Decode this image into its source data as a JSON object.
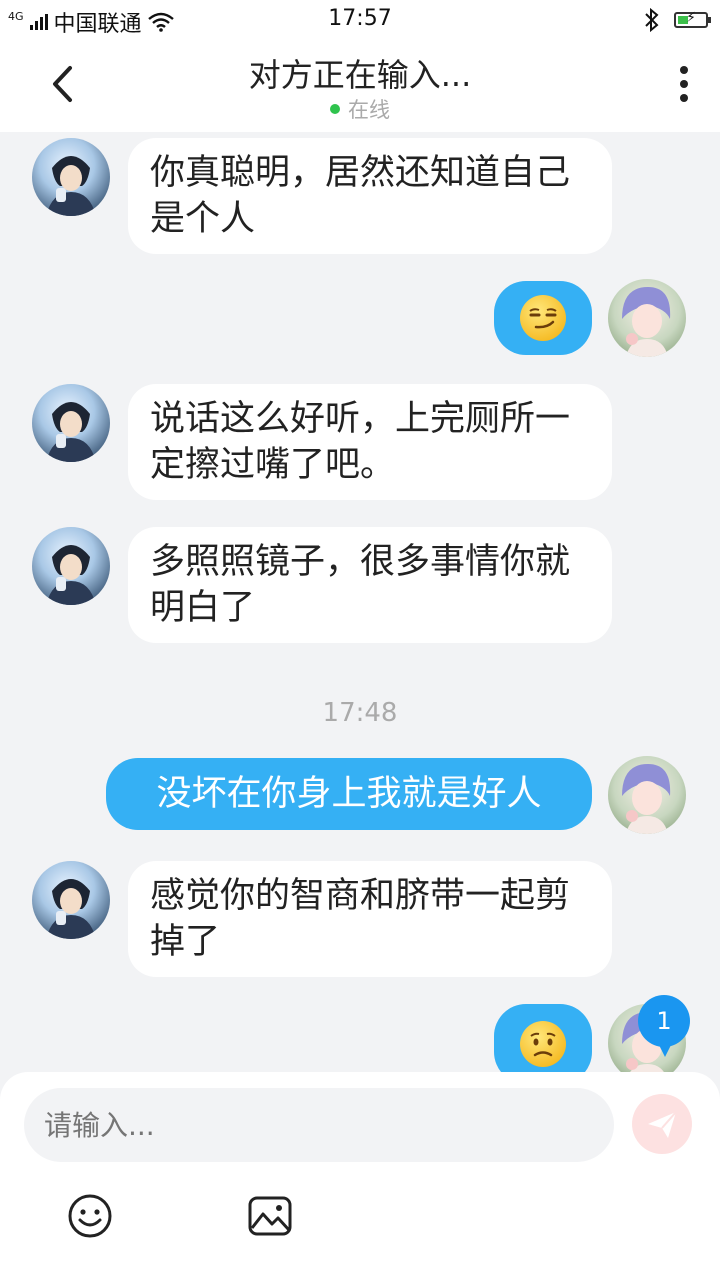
{
  "status_bar": {
    "network": "4G",
    "carrier": "中国联通",
    "time": "17:57"
  },
  "header": {
    "title": "对方正在输入...",
    "status": "在线",
    "online_color": "#2fc34d"
  },
  "messages": [
    {
      "side": "in",
      "text": "你真聪明，居然还知道自己是个人"
    },
    {
      "side": "out",
      "emoji": "smirk"
    },
    {
      "side": "in",
      "text": "说话这么好听，上完厕所一定擦过嘴了吧。"
    },
    {
      "side": "in",
      "text": "多照照镜子，很多事情你就明白了"
    },
    {
      "timestamp": "17:48"
    },
    {
      "side": "out",
      "text": "没坏在你身上我就是好人"
    },
    {
      "side": "in",
      "text": "感觉你的智商和脐带一起剪掉了"
    },
    {
      "side": "out",
      "emoji": "worried"
    }
  ],
  "unread_badge": "1",
  "composer": {
    "placeholder": "请输入...",
    "icons": [
      "emoji-icon",
      "image-icon",
      "send-icon"
    ]
  },
  "colors": {
    "outgoing_bubble": "#35b0f4",
    "incoming_bubble": "#ffffff",
    "background": "#f2f3f5",
    "badge": "#1a96f0"
  }
}
